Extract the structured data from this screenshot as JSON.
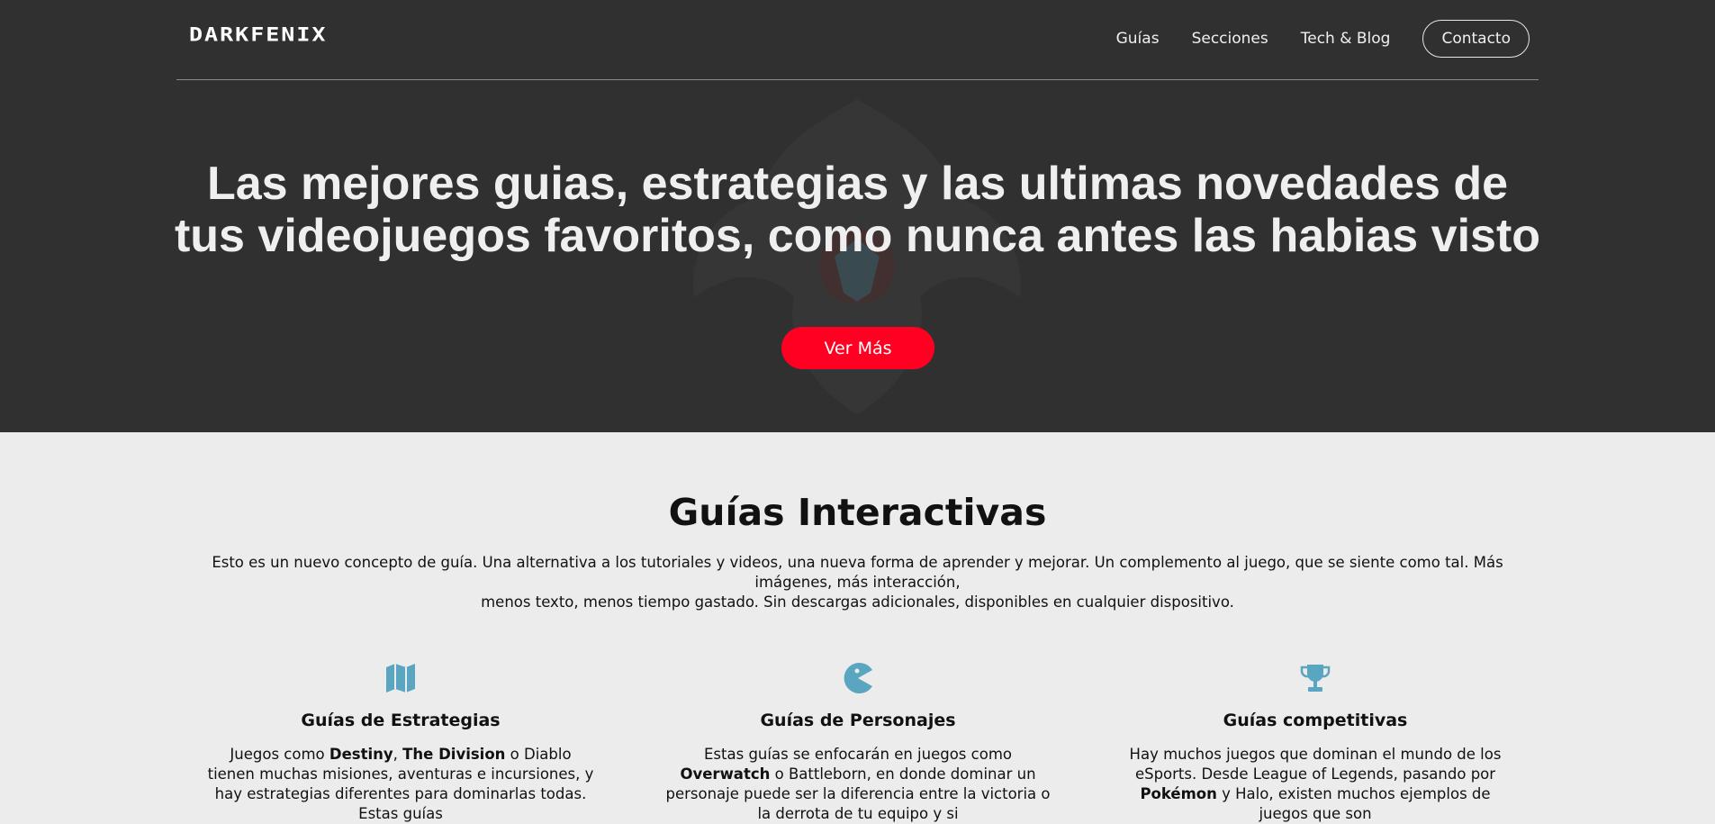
{
  "header": {
    "logo": "DARKFENIX",
    "nav": [
      "Guías",
      "Secciones",
      "Tech & Blog"
    ],
    "contact_label": "Contacto"
  },
  "hero": {
    "title_line1": "Las mejores guias, estrategias y las ultimas novedades de",
    "title_line2": "tus videojuegos favoritos, como nunca antes las habias visto",
    "cta_label": "Ver Más"
  },
  "intro": {
    "title": "Guías Interactivas",
    "description_line1": "Esto es un nuevo concepto de guía. Una alternativa a los tutoriales y videos, una nueva forma de aprender y mejorar. Un complemento al juego, que se siente como tal. Más imágenes, más interacción,",
    "description_line2": "menos texto, menos tiempo gastado. Sin descargas adicionales, disponibles en cualquier dispositivo."
  },
  "features": [
    {
      "icon": "map-icon",
      "title": "Guías de Estrategias",
      "text": [
        {
          "t": "Juegos como ",
          "b": false
        },
        {
          "t": "Destiny",
          "b": true
        },
        {
          "t": ", ",
          "b": false
        },
        {
          "t": "The Division",
          "b": true
        },
        {
          "t": " o Diablo tienen muchas misiones, aventuras e incursiones, y hay estrategias diferentes para dominarlas todas. Estas guías",
          "b": false
        }
      ]
    },
    {
      "icon": "pacman-icon",
      "title": "Guías de Personajes",
      "text": [
        {
          "t": "Estas guías se enfocarán en juegos como ",
          "b": false
        },
        {
          "t": "Overwatch",
          "b": true
        },
        {
          "t": " o Battleborn, en donde dominar un personaje puede ser la diferencia entre la victoria o la derrota de tu equipo y si",
          "b": false
        }
      ]
    },
    {
      "icon": "trophy-icon",
      "title": "Guías competitivas",
      "text": [
        {
          "t": "Hay muchos juegos que dominan el mundo de los eSports. Desde League of Legends, pasando por ",
          "b": false
        },
        {
          "t": "Pokémon",
          "b": true
        },
        {
          "t": " y Halo, existen muchos ejemplos de juegos que son",
          "b": false
        }
      ]
    }
  ],
  "colors": {
    "hero_bg": "#303030",
    "accent_red": "#ff0022",
    "icon_teal": "#5aa6c0",
    "page_bg": "#ececec"
  }
}
